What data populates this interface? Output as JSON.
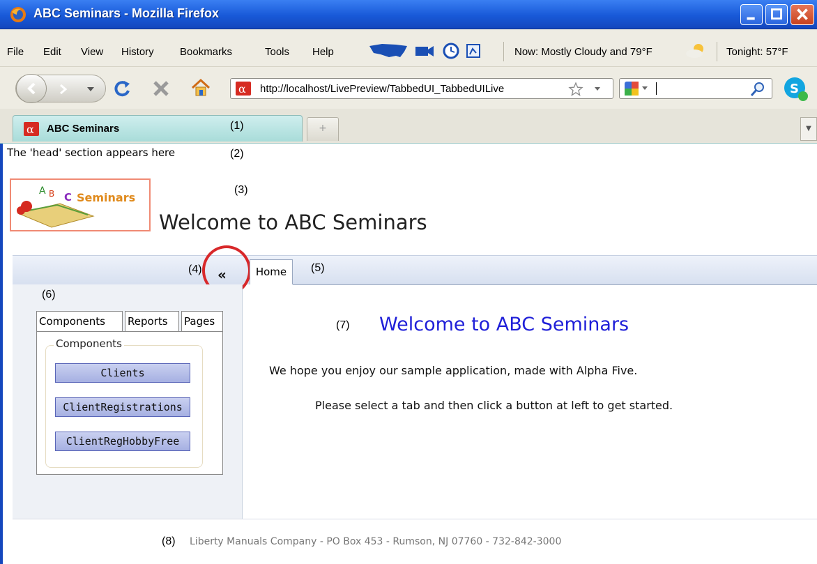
{
  "window": {
    "title": "ABC Seminars - Mozilla Firefox"
  },
  "menu": {
    "items": [
      "File",
      "Edit",
      "View",
      "History",
      "Bookmarks",
      "Tools",
      "Help"
    ],
    "weather_now": "Now: Mostly Cloudy and 79°F",
    "weather_tonight": "Tonight: 57°F"
  },
  "nav": {
    "url": "http://localhost/LivePreview/TabbedUI_TabbedUILive",
    "search_value": ""
  },
  "browser_tab": {
    "label": "ABC Seminars",
    "new_tab": "+"
  },
  "page": {
    "head_note": "The 'head' section appears here",
    "logo_letters": "ABC Seminars",
    "heading": "Welcome to ABC Seminars",
    "collapse_label": "«",
    "home_tab": "Home",
    "nav_tabs": [
      "Components",
      "Reports",
      "Pages"
    ],
    "group_legend": "Components",
    "component_buttons": [
      "Clients",
      "ClientRegistrations",
      "ClientRegHobbyFree"
    ],
    "main_title": "Welcome to ABC Seminars",
    "main_line1": "We hope you enjoy our sample application, made with Alpha Five.",
    "main_line2": "Please select a tab and then click a button at left to get started.",
    "footer": "Liberty Manuals Company - PO Box 453 - Rumson, NJ 07760 - 732-842-3000"
  },
  "annotations": [
    "(1)",
    "(2)",
    "(3)",
    "(4)",
    "(5)",
    "(6)",
    "(7)",
    "(8)"
  ],
  "colors": {
    "titlebar": "#1859d8",
    "tab_active": "#a8dcd9",
    "main_title": "#1f1fd8",
    "highlight_circle": "#d8282a",
    "component_button": "#a6b0e2"
  }
}
